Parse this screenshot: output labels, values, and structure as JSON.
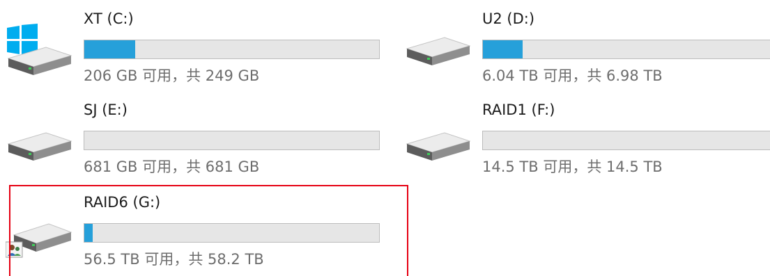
{
  "drives": [
    {
      "name": "XT (C:)",
      "space": "206 GB 可用，共 249 GB",
      "used_fraction": 0.173,
      "icon": "windows-system-drive-icon"
    },
    {
      "name": "U2 (D:)",
      "space": "6.04 TB 可用，共 6.98 TB",
      "used_fraction": 0.135,
      "icon": "hard-drive-icon"
    },
    {
      "name": "SJ (E:)",
      "space": "681 GB 可用，共 681 GB",
      "used_fraction": 0.0,
      "icon": "hard-drive-icon"
    },
    {
      "name": "RAID1 (F:)",
      "space": "14.5 TB 可用，共 14.5 TB",
      "used_fraction": 0.0,
      "icon": "hard-drive-icon"
    },
    {
      "name": "RAID6 (G:)",
      "space": "56.5 TB 可用，共 58.2 TB",
      "used_fraction": 0.029,
      "icon": "shared-drive-icon"
    }
  ],
  "colors": {
    "bar_fill": "#26a0da",
    "bar_track": "#e6e6e6",
    "highlight_box": "#e60012"
  }
}
